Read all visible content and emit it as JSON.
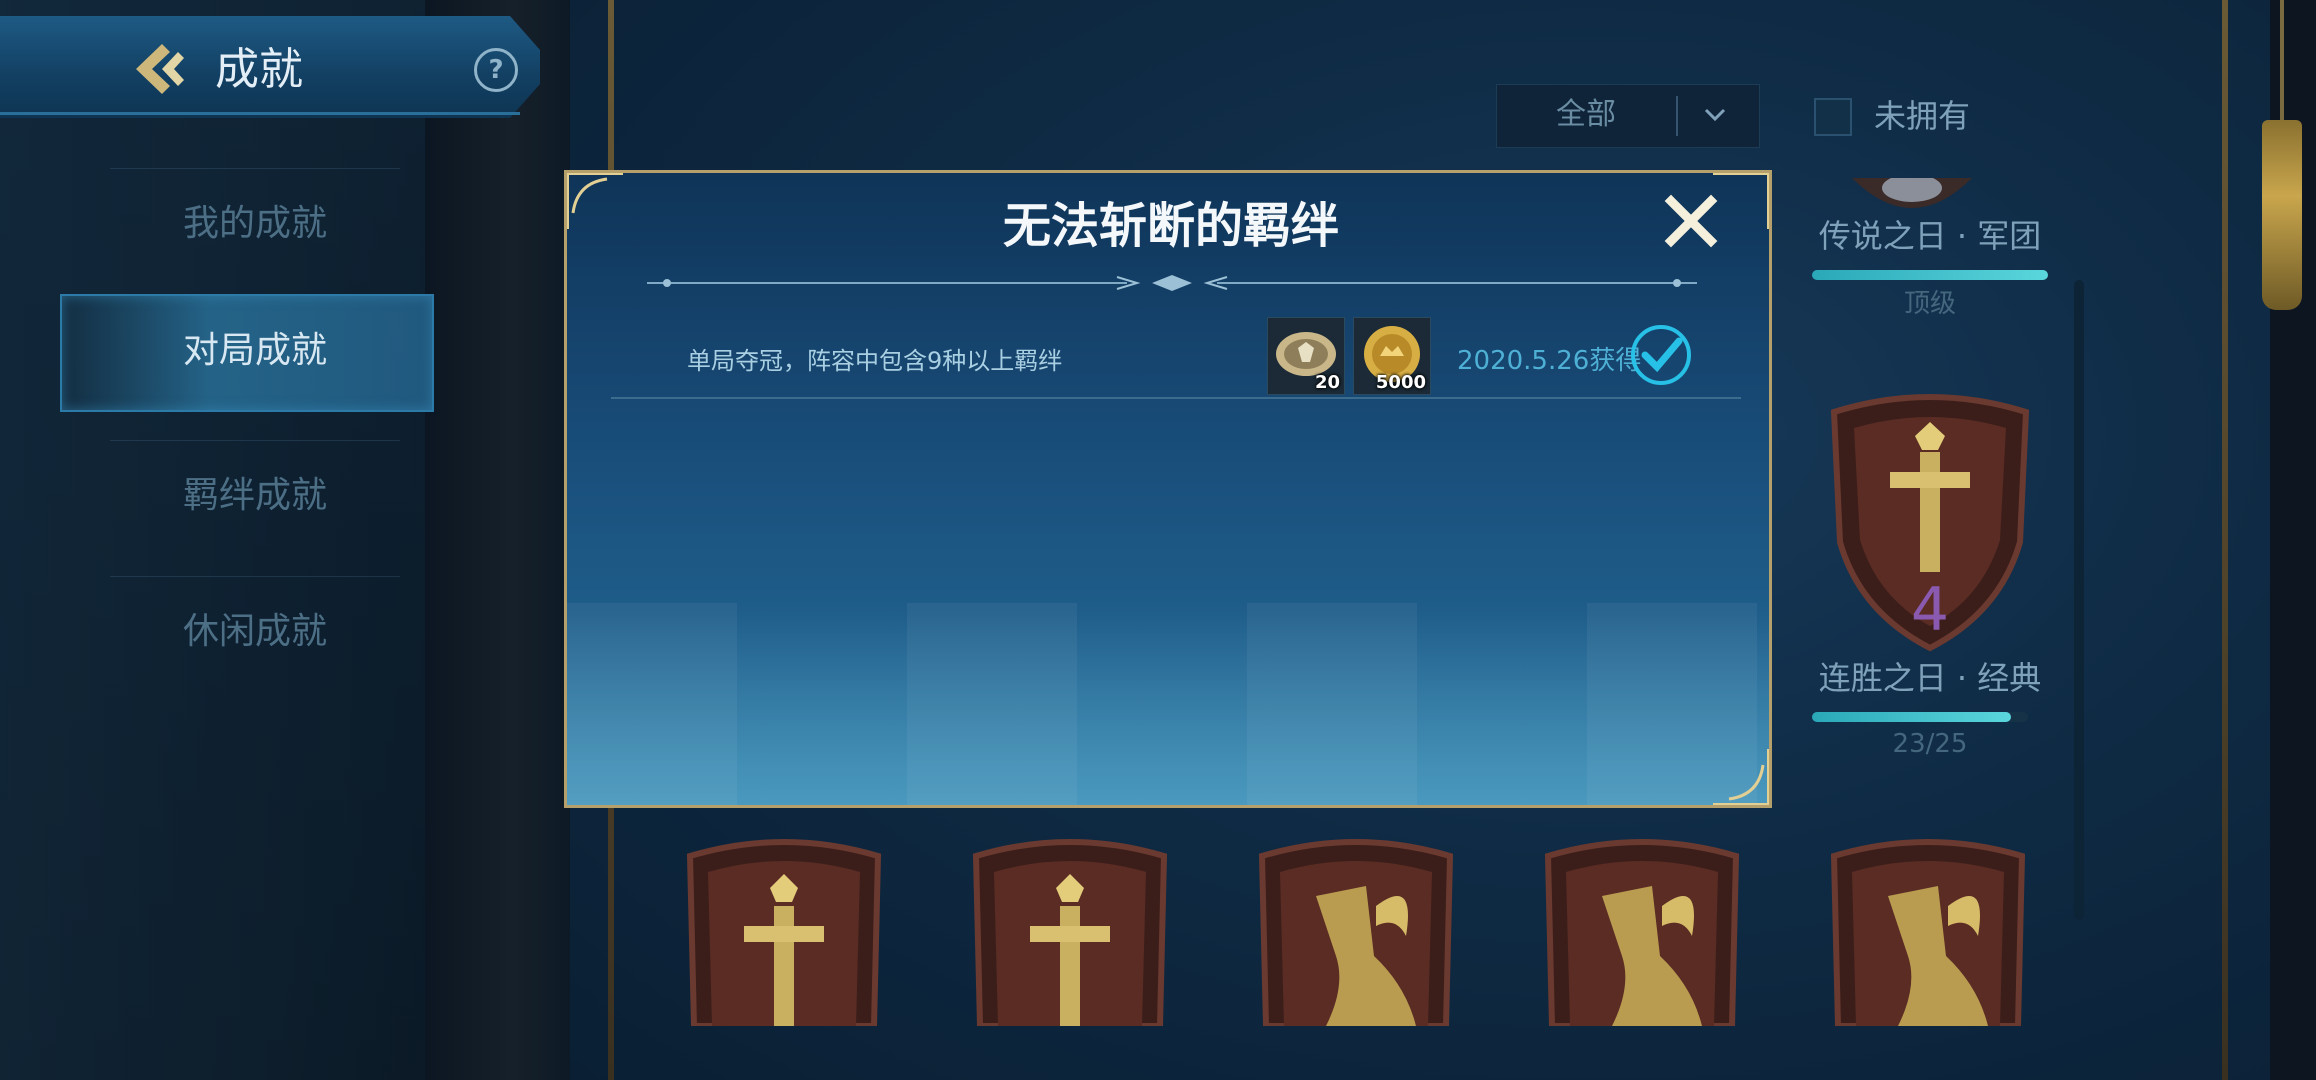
{
  "header": {
    "title": "成就",
    "back_icon": "back-arrow-icon",
    "help_icon": "help-icon",
    "help_glyph": "?"
  },
  "sidebar": {
    "items": [
      {
        "label": "我的成就",
        "active": false
      },
      {
        "label": "对局成就",
        "active": true
      },
      {
        "label": "羁绊成就",
        "active": false
      },
      {
        "label": "休闲成就",
        "active": false
      }
    ]
  },
  "filter": {
    "selected": "全部",
    "owned_label": "未拥有",
    "owned_checked": false
  },
  "right_cards": [
    {
      "name": "传说之日 · 军团",
      "progress_text": "顶级",
      "progress": 1.0
    },
    {
      "name": "连胜之日 · 经典",
      "progress_text": "23/25",
      "progress": 0.92
    }
  ],
  "badge_row": [
    {
      "icon": "sword-shield-badge-icon"
    },
    {
      "icon": "sword-shield-badge-icon"
    },
    {
      "icon": "boot-shield-badge-icon"
    },
    {
      "icon": "boot-shield-badge-icon"
    },
    {
      "icon": "boot-shield-badge-icon"
    }
  ],
  "modal": {
    "title": "无法斩断的羁绊",
    "close_label": "X",
    "row": {
      "description": "单局夺冠，阵容中包含9种以上羁绊",
      "rewards": [
        {
          "icon": "silver-medal-reward-icon",
          "count": "20"
        },
        {
          "icon": "gold-coin-reward-icon",
          "count": "5000"
        }
      ],
      "date": "2020.5.26获得",
      "completed": true
    }
  },
  "colors": {
    "accent": "#4fb0d6",
    "gold_trim": "#b5a06c",
    "check": "#27c0e6"
  }
}
